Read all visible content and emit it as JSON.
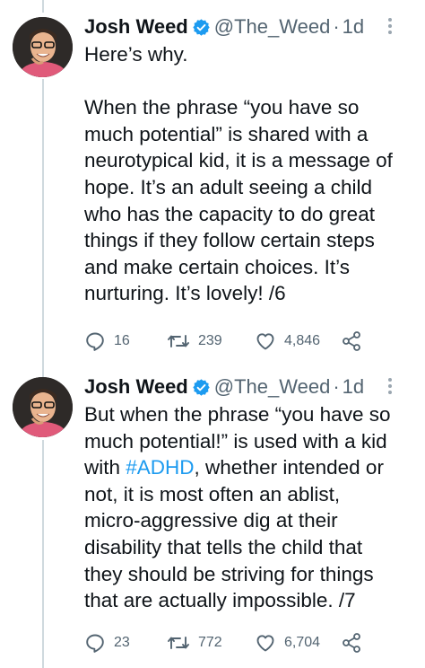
{
  "tweets": [
    {
      "name": "Josh Weed",
      "handle": "@The_Weed",
      "separator": "·",
      "time": "1d",
      "lines": [
        "Here’s why.",
        "",
        "When the phrase “you have so",
        "much potential” is shared with a",
        "neurotypical kid, it is a message of",
        "hope. It’s an adult seeing a child",
        "who has the capacity to do great",
        "things if they follow certain steps",
        "and make certain choices. It’s",
        "nurturing. It’s lovely! /6"
      ],
      "replies": "16",
      "retweets": "239",
      "likes": "4,846"
    },
    {
      "name": "Josh Weed",
      "handle": "@The_Weed",
      "separator": "·",
      "time": "1d",
      "lines": [
        "But when the phrase “you have so",
        "much potential!” is used with a kid",
        "with ",
        "not, it is most often an ablist,",
        "micro-aggressive dig at their",
        "disability that tells the child that",
        "they should be striving for things",
        "that are actually impossible. /7"
      ],
      "hashtag": "#ADHD",
      "hashtag_after": ", whether intended or",
      "replies": "23",
      "retweets": "772",
      "likes": "6,704"
    }
  ],
  "colors": {
    "text": "#0f1419",
    "secondary": "#536471",
    "link": "#1d9bf0",
    "verified": "#1d9bf0",
    "thread_line": "#cfd9de"
  },
  "icons": [
    "verified-badge-icon",
    "more-options-icon",
    "reply-icon",
    "retweet-icon",
    "like-icon",
    "share-icon"
  ]
}
